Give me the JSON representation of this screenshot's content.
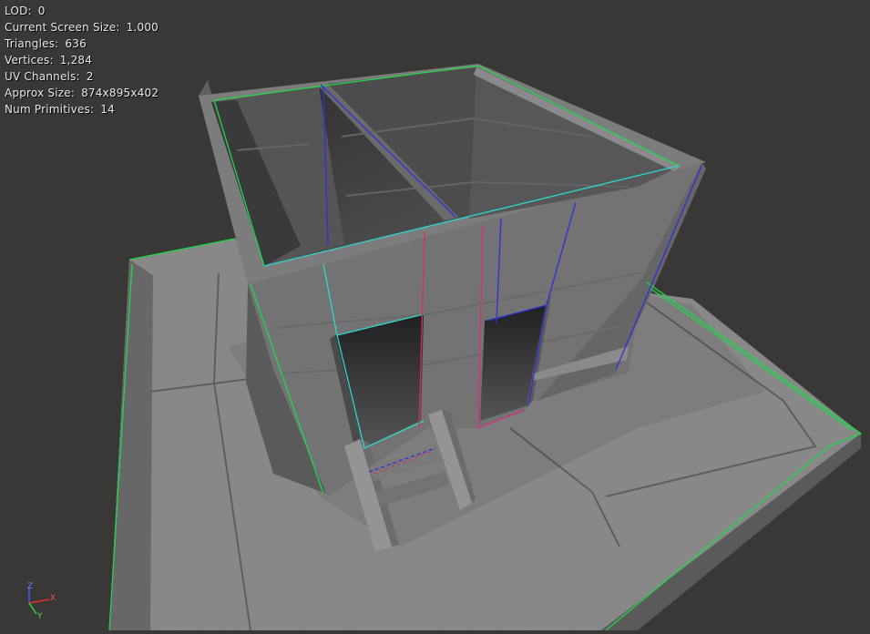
{
  "stats": [
    {
      "label": "LOD:",
      "value": "0"
    },
    {
      "label": "Current Screen Size:",
      "value": "1.000"
    },
    {
      "label": "Triangles:",
      "value": "636"
    },
    {
      "label": "Vertices:",
      "value": "1,284"
    },
    {
      "label": "UV Channels:",
      "value": "2"
    },
    {
      "label": "Approx Size:",
      "value": "874x895x402"
    },
    {
      "label": "Num Primitives:",
      "value": "14"
    }
  ],
  "axes": {
    "z": "Z",
    "x": "X",
    "y": "Y"
  },
  "colors": {
    "background": "#3a3836",
    "wall": "#6e6e6e",
    "floor": "#8a8a8a",
    "bounds_green": "#1fd84a",
    "collision_cyan": "#2ed6d0",
    "collision_blue": "#2a32d8",
    "collision_red": "#d83060"
  }
}
